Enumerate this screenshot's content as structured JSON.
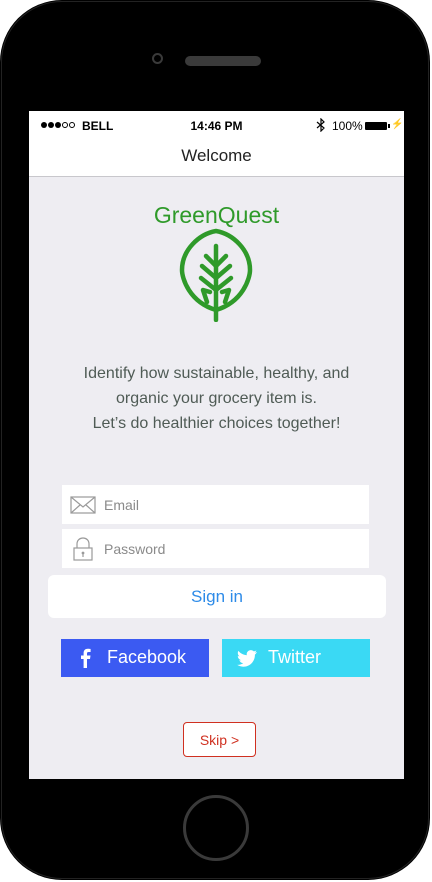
{
  "status_bar": {
    "carrier": "BELL",
    "time": "14:46 PM",
    "battery_percent": "100%",
    "signal_strength": 3
  },
  "nav": {
    "title": "Welcome"
  },
  "brand": {
    "name": "GreenQuest",
    "color": "#2f9a2a",
    "logo_icon": "leaf-icon"
  },
  "tagline": {
    "line1": "Identify how sustainable, healthy, and",
    "line2": "organic your grocery item is.",
    "line3": "Let’s do healthier choices together!"
  },
  "form": {
    "email": {
      "placeholder": "Email",
      "value": "",
      "icon": "envelope-icon"
    },
    "password": {
      "placeholder": "Password",
      "value": "",
      "icon": "lock-icon"
    },
    "signin_label": "Sign in"
  },
  "social": {
    "facebook_label": "Facebook",
    "facebook_color": "#3b5af2",
    "twitter_label": "Twitter",
    "twitter_color": "#3ad9f4"
  },
  "skip": {
    "label": "Skip >",
    "color": "#d03020"
  }
}
